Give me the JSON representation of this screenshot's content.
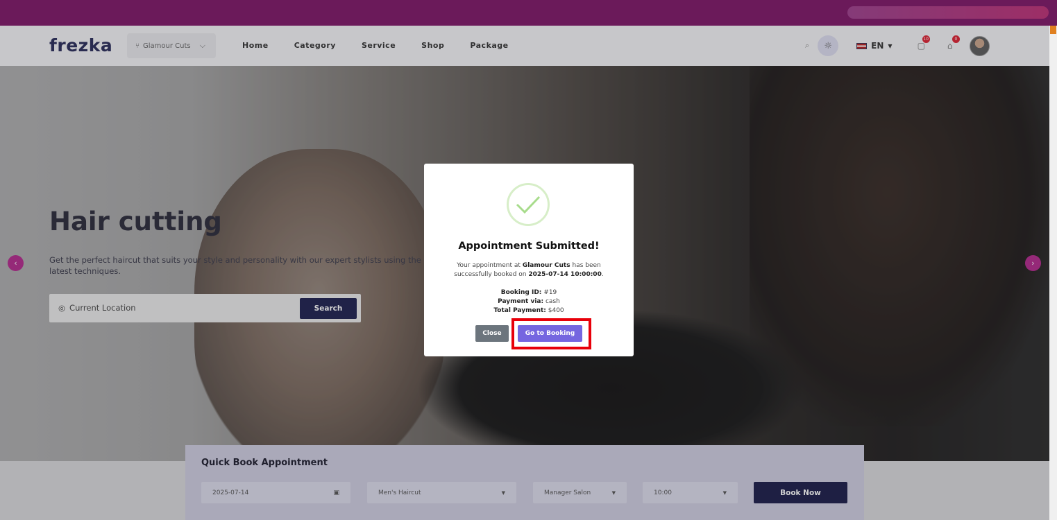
{
  "header": {
    "logo": "frezka",
    "branch": "Glamour Cuts",
    "nav": [
      "Home",
      "Category",
      "Service",
      "Shop",
      "Package"
    ],
    "language": "EN",
    "notifications_count": "10",
    "cart_count": "0"
  },
  "hero": {
    "title": "Hair cutting",
    "description": "Get the perfect haircut that suits your style and personality with our expert stylists using the latest techniques.",
    "search_placeholder": "Current Location",
    "search_button": "Search"
  },
  "quick_book": {
    "title": "Quick Book Appointment",
    "date": "2025-07-14",
    "service": "Men's Haircut",
    "staff": "Manager Salon",
    "time": "10:00",
    "button": "Book Now"
  },
  "modal": {
    "title": "Appointment Submitted!",
    "msg_prefix": "Your appointment at",
    "salon": "Glamour Cuts",
    "msg_mid": "has been successfully booked on",
    "datetime": "2025-07-14 10:00:00",
    "booking_id_label": "Booking ID:",
    "booking_id": "#19",
    "payment_label": "Payment via:",
    "payment": "cash",
    "total_label": "Total Payment:",
    "total": "$400",
    "close": "Close",
    "go": "Go to Booking"
  },
  "colors": {
    "topbar": "#6b1a5a",
    "primary_navy": "#1e2050",
    "accent_purple": "#7566e0",
    "highlight_red": "#e8000a"
  }
}
